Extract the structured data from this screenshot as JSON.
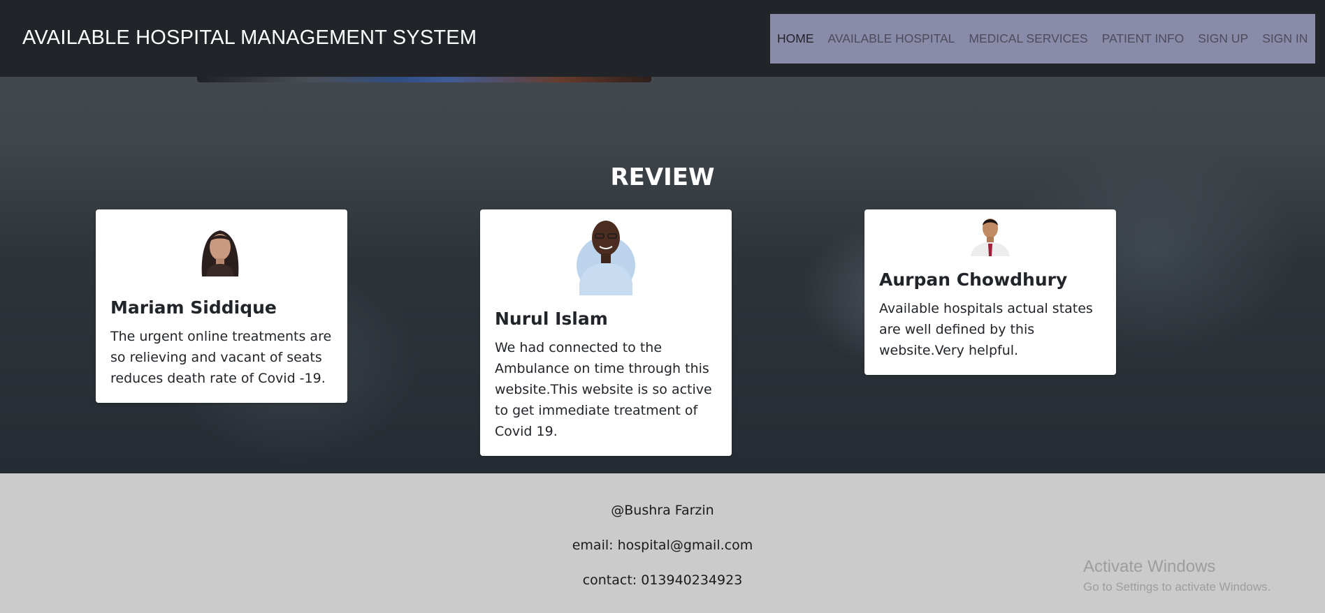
{
  "navbar": {
    "brand": "AVAILABLE HOSPITAL MANAGEMENT SYSTEM",
    "menu_bg": "#8a8aa9",
    "items": [
      {
        "label": "HOME",
        "active": true
      },
      {
        "label": "AVAILABLE HOSPITAL",
        "active": false
      },
      {
        "label": "MEDICAL SERVICES",
        "active": false
      },
      {
        "label": "PATIENT INFO",
        "active": false
      },
      {
        "label": "SIGN UP",
        "active": false
      },
      {
        "label": "SIGN IN",
        "active": false
      }
    ]
  },
  "review": {
    "title": "REVIEW",
    "cards": [
      {
        "name": "Mariam Siddique",
        "text": "The urgent online treatments are so relieving and vacant of seats reduces death rate of Covid -19."
      },
      {
        "name": "Nurul Islam",
        "text": "We had connected to the Ambulance on time through this website.This website is so active to get immediate treatment of Covid 19."
      },
      {
        "name": "Aurpan Chowdhury",
        "text": "Available hospitals actual states are well defined by this website.Very helpful."
      }
    ]
  },
  "footer": {
    "author": "@Bushra Farzin",
    "email": "email: hospital@gmail.com",
    "contact": "contact: 013940234923"
  },
  "watermark": {
    "title": "Activate Windows",
    "subtitle": "Go to Settings to activate Windows."
  }
}
